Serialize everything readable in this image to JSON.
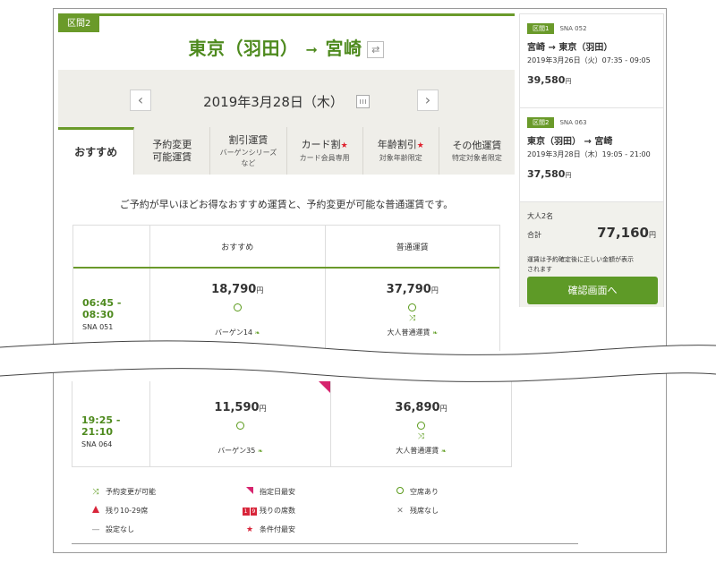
{
  "route": {
    "section_badge": "区間2",
    "title_from": "東京（羽田）",
    "title_arrow": "➞",
    "title_to": "宮崎",
    "swap_icon": "⇄"
  },
  "date_nav": {
    "prev": "‹",
    "next": "›",
    "date": "2019年3月28日（木）"
  },
  "tabs": [
    {
      "label": "おすすめ",
      "sub": ""
    },
    {
      "label": "予約変更",
      "sub2": "可能運賃"
    },
    {
      "label": "割引運賃",
      "sub": "バーゲンシリーズ",
      "sub_line2": "など"
    },
    {
      "label": "カード割",
      "sub": "カード会員専用"
    },
    {
      "label": "年齢割引",
      "sub": "対象年齢限定"
    },
    {
      "label": "その他運賃",
      "sub": "特定対象者限定"
    }
  ],
  "intro": "ご予約が早いほどお得なおすすめ運賃と、予約変更が可能な普通運賃です。",
  "table": {
    "col1": "おすすめ",
    "col2": "普通運賃",
    "rows": [
      {
        "time": "06:45 - 08:30",
        "flight": "SNA 051",
        "fare1": {
          "price": "18,790",
          "yen": "円",
          "name": "バーゲン14"
        },
        "fare2": {
          "price": "37,790",
          "yen": "円",
          "name": "大人普通運賃"
        }
      }
    ],
    "lower_rows": [
      {
        "time": "19:25 - 21:10",
        "flight": "SNA 064",
        "fare1": {
          "price": "11,590",
          "yen": "円",
          "name": "バーゲン35"
        },
        "fare2": {
          "price": "36,890",
          "yen": "円",
          "name": "大人普通運賃"
        }
      }
    ]
  },
  "legend": [
    [
      "予約変更が可能",
      "指定日最安",
      "空席あり"
    ],
    [
      "残り10-29席",
      "残りの席数",
      "残席なし"
    ],
    [
      "設定なし",
      "条件付最安",
      ""
    ]
  ],
  "legend_seats": [
    "1",
    "9"
  ],
  "sidebar": {
    "segments": [
      {
        "badge": "区間1",
        "flight": "SNA 052",
        "route": "宮崎 → 東京（羽田）",
        "date": "2019年3月26日（火）07:35 - 09:05",
        "price": "39,580",
        "yen": "円"
      },
      {
        "badge": "区間2",
        "flight": "SNA 063",
        "route": "東京（羽田） → 宮崎",
        "date": "2019年3月28日（木）19:05 - 21:00",
        "price": "37,580",
        "yen": "円"
      }
    ],
    "pax": "大人2名",
    "total_label": "合計",
    "total_price": "77,160",
    "total_yen": "円",
    "note_line1": "運賃は予約確定後に正しい金額が表示",
    "note_line2": "されます",
    "confirm": "確認画面へ"
  },
  "colors": {
    "brand_green": "#6a9a2a",
    "flag_pink": "#d6246e",
    "star_red": "#e0212e"
  }
}
